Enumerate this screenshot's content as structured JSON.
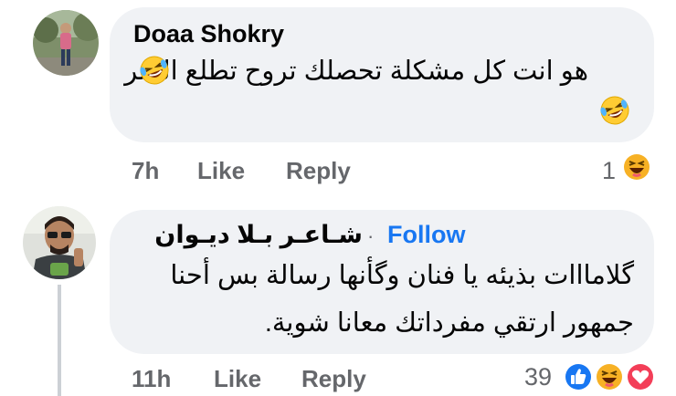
{
  "comments": [
    {
      "author": "Doaa Shokry",
      "text_line1": "هو انت كل مشكلة تحصلك تروح تطلع النمر",
      "time": "7h",
      "like_label": "Like",
      "reply_label": "Reply",
      "reaction_count": "1",
      "reactions": [
        "laughing-emoji-icon"
      ]
    },
    {
      "author": "شـاعـر بـلا ديـوان",
      "follow_label": "Follow",
      "separator": "·",
      "text_line1": "گلامااات بذيئه يا فنان وگأنها رسالة بس أحنا",
      "text_line2": "جمهور ارتقي مفرداتك معانا شوية.",
      "time": "11h",
      "like_label": "Like",
      "reply_label": "Reply",
      "reaction_count": "39",
      "reactions": [
        "like-icon",
        "haha-icon",
        "love-icon"
      ]
    }
  ],
  "colors": {
    "bubble": "#f0f2f5",
    "meta_text": "#65676b",
    "follow_blue": "#1877f2",
    "like_blue": "#1877f2",
    "love_red": "#f33e58",
    "haha_yellow": "#f7b125"
  }
}
